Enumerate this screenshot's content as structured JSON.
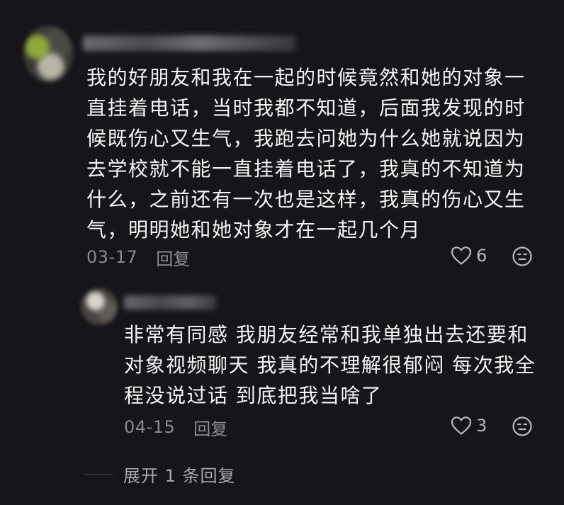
{
  "main_comment": {
    "content_lines": [
      "我的好朋友和我在一起的时候竟然和她的对象一",
      "直挂着电话，当时我都不知道，后面我发现的时",
      "候既伤心又生气，我跑去问她为什么她就说因为",
      "去学校就不能一直挂着电话了，我真的不知道为",
      "什么，之前还有一次也是这样，我真的伤心又生",
      "气，明明她和她对象才在一起几个月"
    ],
    "date": "03-17",
    "reply_label": "回复",
    "like_count": "6",
    "like_icon": "heart-outline-icon",
    "emoji_icon": "emoji-face-icon"
  },
  "reply_comment": {
    "content_lines": [
      "非常有同感 我朋友经常和我单独出去还要和",
      "对象视频聊天 我真的不理解很郁闷 每次我全",
      "程没说过话 到底把我当啥了"
    ],
    "date": "04-15",
    "reply_label": "回复",
    "like_count": "3",
    "like_icon": "heart-outline-icon",
    "emoji_icon": "emoji-face-icon"
  },
  "expand_replies": {
    "label": "展开 1 条回复"
  },
  "colors": {
    "background": "#161519",
    "text_primary": "#f4f4f6",
    "text_secondary": "#8a898f"
  }
}
